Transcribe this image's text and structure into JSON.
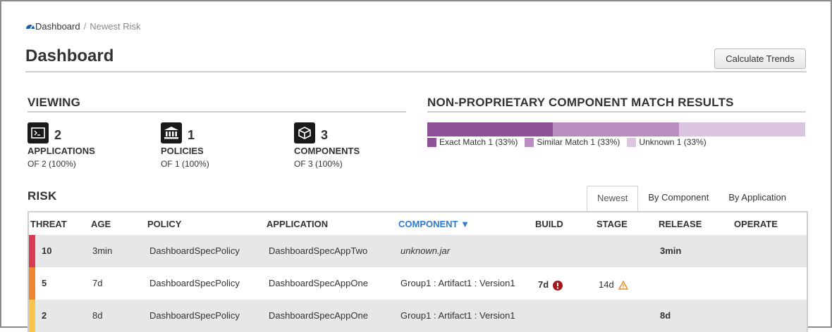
{
  "breadcrumb": {
    "home": "Dashboard",
    "separator": "/",
    "current": "Newest Risk"
  },
  "page": {
    "title": "Dashboard",
    "calculate_button": "Calculate Trends"
  },
  "viewing": {
    "heading": "VIEWING",
    "stats": [
      {
        "icon": "terminal-icon",
        "count": "2",
        "label": "APPLICATIONS",
        "sub": "OF 2 (100%)"
      },
      {
        "icon": "bank-icon",
        "count": "1",
        "label": "POLICIES",
        "sub": "OF 1 (100%)"
      },
      {
        "icon": "cube-icon",
        "count": "3",
        "label": "COMPONENTS",
        "sub": "OF 3 (100%)"
      }
    ]
  },
  "match_results": {
    "heading": "NON-PROPRIETARY COMPONENT MATCH RESULTS",
    "segments": [
      {
        "label": "Exact Match 1 (33%)",
        "fraction": 0.333,
        "color": "#8e5199"
      },
      {
        "label": "Similar Match 1 (33%)",
        "fraction": 0.333,
        "color": "#b88ec0"
      },
      {
        "label": "Unknown 1 (33%)",
        "fraction": 0.334,
        "color": "#dcc5e0"
      }
    ]
  },
  "risk": {
    "heading": "RISK",
    "tabs": [
      "Newest",
      "By Component",
      "By Application"
    ],
    "active_tab": "Newest",
    "columns": [
      "THREAT",
      "AGE",
      "POLICY",
      "APPLICATION",
      "COMPONENT",
      "BUILD",
      "STAGE",
      "RELEASE",
      "OPERATE"
    ],
    "sort_column": "COMPONENT",
    "sort_arrow": "▼",
    "rows": [
      {
        "threat": "10",
        "threat_color": "#d93a53",
        "age": "3min",
        "policy": "DashboardSpecPolicy",
        "application": "DashboardSpecAppTwo",
        "component": "unknown.jar",
        "build": "",
        "stage": "",
        "release": "3min",
        "operate": ""
      },
      {
        "threat": "5",
        "threat_color": "#f0872e",
        "age": "7d",
        "policy": "DashboardSpecPolicy",
        "application": "DashboardSpecAppOne",
        "component": "Group1 : Artifact1 : Version1",
        "build": "7d",
        "build_icon": "error-icon",
        "stage": "14d",
        "stage_icon": "warning-icon",
        "release": "",
        "operate": ""
      },
      {
        "threat": "2",
        "threat_color": "#f6c74b",
        "age": "8d",
        "policy": "DashboardSpecPolicy",
        "application": "DashboardSpecAppOne",
        "component": "Group1 : Artifact1 : Version1",
        "build": "",
        "stage": "",
        "release": "8d",
        "operate": ""
      }
    ]
  }
}
